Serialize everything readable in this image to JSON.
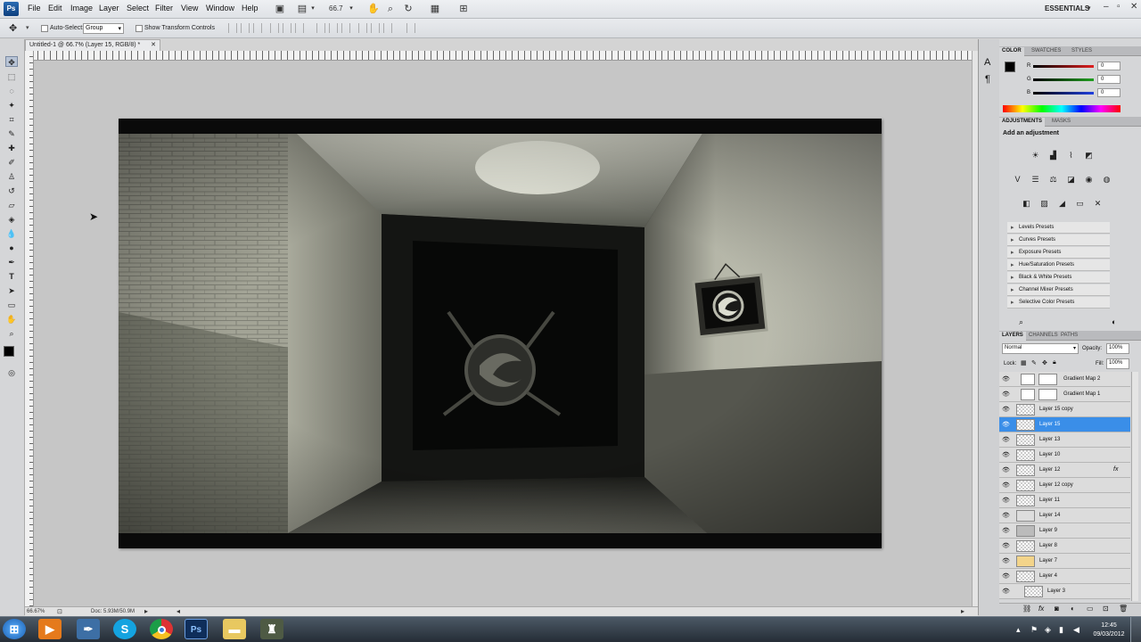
{
  "app": {
    "logo": "Ps"
  },
  "menu": [
    "File",
    "Edit",
    "Image",
    "Layer",
    "Select",
    "Filter",
    "View",
    "Window",
    "Help"
  ],
  "zoom_field": "66.7",
  "workspace": "ESSENTIALS",
  "options": {
    "auto_select_label": "Auto-Select:",
    "auto_select_value": "Group",
    "transform_label": "Show Transform Controls"
  },
  "document": {
    "tab_title": "Untitled-1 @ 66.7% (Layer 15, RGB/8) *"
  },
  "status": {
    "zoom": "66.67%",
    "doc_size": "Doc: 5.93M/50.9M"
  },
  "color_panel": {
    "tabs": [
      "COLOR",
      "SWATCHES",
      "STYLES"
    ],
    "channels": [
      {
        "label": "R",
        "value": "0",
        "color": "#e02020"
      },
      {
        "label": "G",
        "value": "0",
        "color": "#20a020"
      },
      {
        "label": "B",
        "value": "0",
        "color": "#2040e0"
      }
    ]
  },
  "adjustments_panel": {
    "tabs": [
      "ADJUSTMENTS",
      "MASKS"
    ],
    "heading": "Add an adjustment",
    "presets": [
      "Levels Presets",
      "Curves Presets",
      "Exposure Presets",
      "Hue/Saturation Presets",
      "Black & White Presets",
      "Channel Mixer Presets",
      "Selective Color Presets"
    ]
  },
  "layers_panel": {
    "tabs": [
      "LAYERS",
      "CHANNELS",
      "PATHS"
    ],
    "blend_mode": "Normal",
    "opacity_label": "Opacity:",
    "opacity_value": "100%",
    "lock_label": "Lock:",
    "fill_label": "Fill:",
    "fill_value": "100%",
    "fx": "fx",
    "layers": [
      {
        "name": "Gradient Map 2",
        "kind": "adjustment"
      },
      {
        "name": "Gradient Map 1",
        "kind": "adjustment"
      },
      {
        "name": "Layer 15 copy",
        "kind": "pixel"
      },
      {
        "name": "Layer 15",
        "kind": "pixel",
        "selected": true
      },
      {
        "name": "Layer 13",
        "kind": "pixel"
      },
      {
        "name": "Layer 10",
        "kind": "pixel"
      },
      {
        "name": "Layer 12",
        "kind": "pixel",
        "fx": true
      },
      {
        "name": "Layer 12 copy",
        "kind": "pixel"
      },
      {
        "name": "Layer 11",
        "kind": "pixel"
      },
      {
        "name": "Layer 14",
        "kind": "pixel"
      },
      {
        "name": "Layer 9",
        "kind": "pixel"
      },
      {
        "name": "Layer 8",
        "kind": "pixel"
      },
      {
        "name": "Layer 7",
        "kind": "pixel"
      },
      {
        "name": "Layer 4",
        "kind": "pixel"
      },
      {
        "name": "Layer 3",
        "kind": "pixel"
      }
    ]
  },
  "taskbar": {
    "apps": [
      "windows-start",
      "media-player",
      "inkscape",
      "skype",
      "chrome",
      "photoshop",
      "folder",
      "tool-app"
    ],
    "time": "12:45",
    "date": "09/03/2012"
  }
}
